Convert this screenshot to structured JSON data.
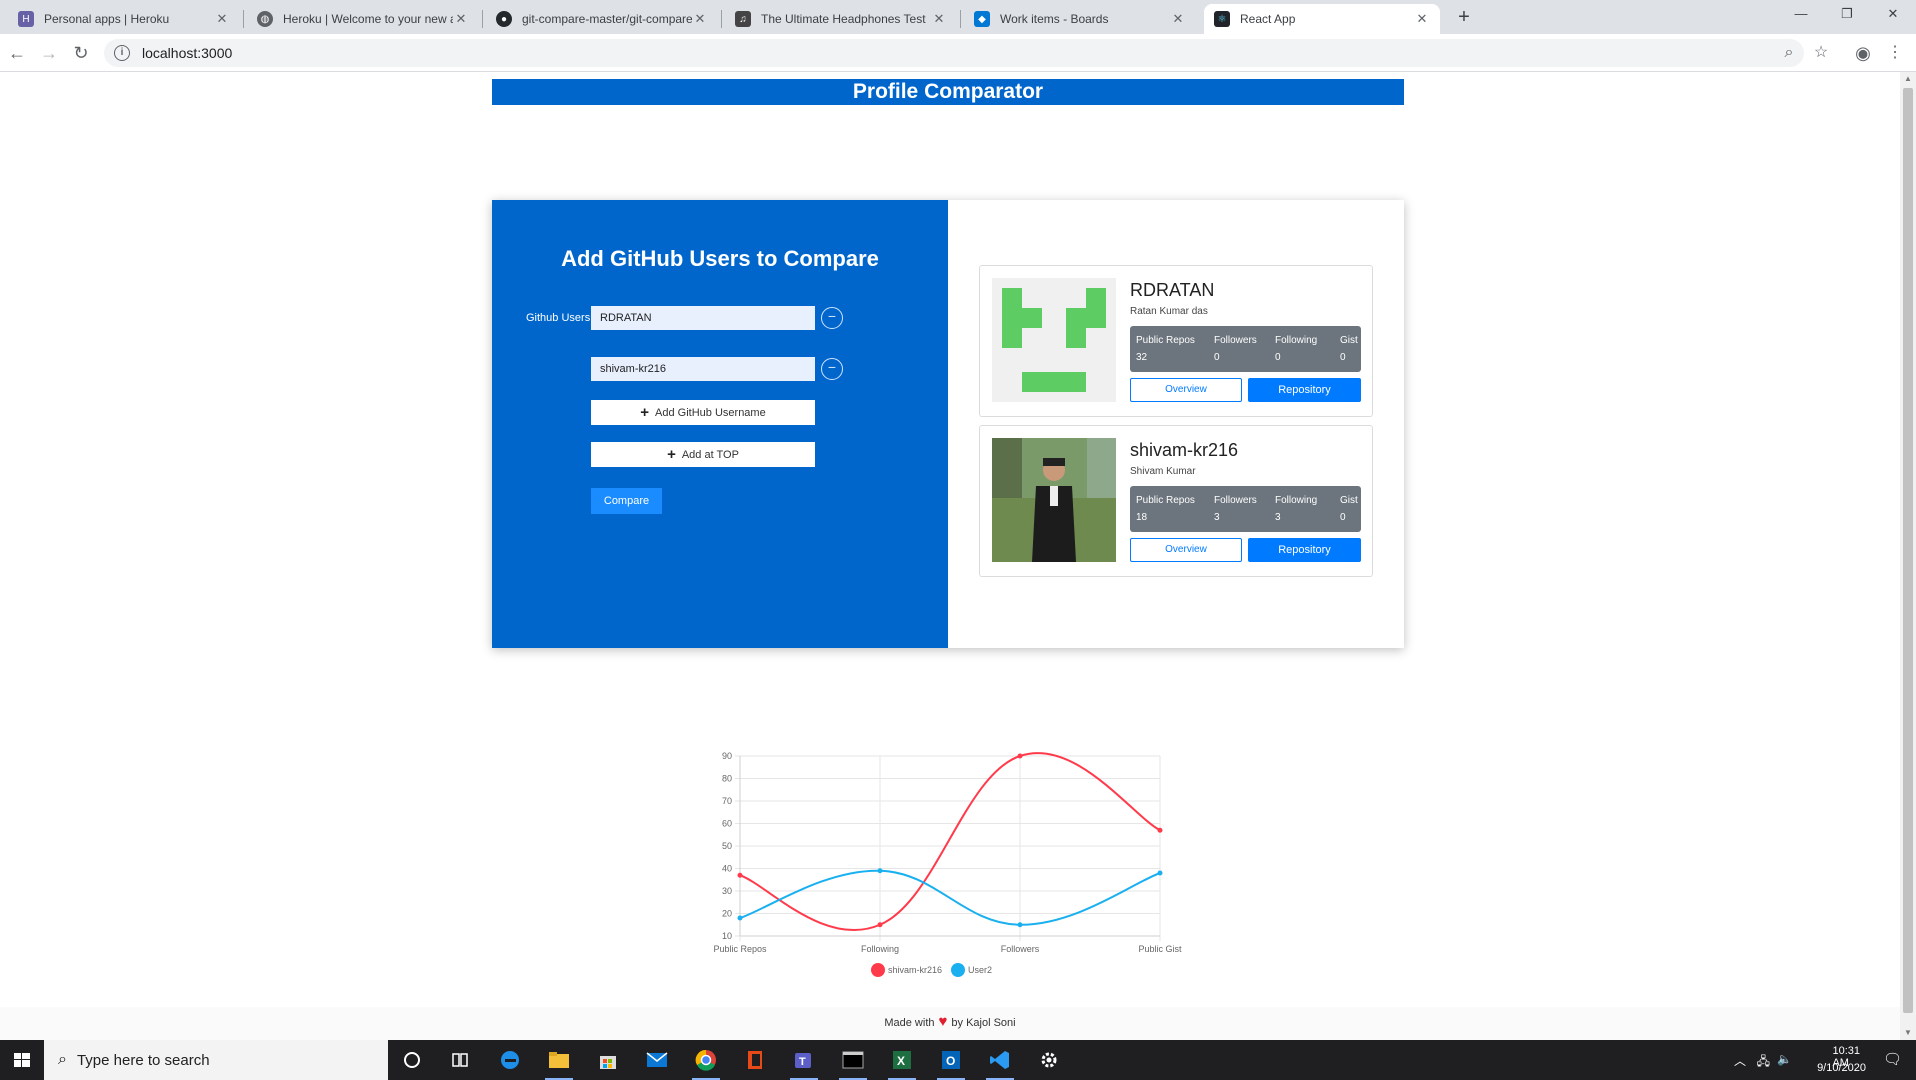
{
  "browser": {
    "tabs": [
      {
        "title": "Personal apps | Heroku",
        "icon": "heroku-icon",
        "color": "#6762a6"
      },
      {
        "title": "Heroku | Welcome to your new a",
        "icon": "globe-icon",
        "color": "#5f6368"
      },
      {
        "title": "git-compare-master/git-compare",
        "icon": "github-icon",
        "color": "#24292e"
      },
      {
        "title": "The Ultimate Headphones Test",
        "icon": "headphones-icon",
        "color": "#444444"
      },
      {
        "title": "Work items - Boards",
        "icon": "azure-devops-icon",
        "color": "#0078d4"
      },
      {
        "title": "React App",
        "icon": "react-icon",
        "color": "#20232a"
      }
    ],
    "active_tab": 5,
    "url": "localhost:3000"
  },
  "page": {
    "banner_title": "Profile Comparator",
    "form": {
      "title": "Add GitHub Users to Compare",
      "users_label": "Github Users",
      "usernames": [
        "RDRATAN",
        "shivam-kr216"
      ],
      "add_username_label": "Add GitHub Username",
      "add_top_label": "Add at TOP",
      "compare_label": "Compare"
    },
    "stat_headers": [
      "Public Repos",
      "Followers",
      "Following",
      "Gist"
    ],
    "profiles": [
      {
        "username": "RDRATAN",
        "name": "Ratan Kumar das",
        "stats": [
          "32",
          "0",
          "0",
          "0"
        ],
        "overview_label": "Overview",
        "repo_label": "Repository"
      },
      {
        "username": "shivam-kr216",
        "name": "Shivam Kumar",
        "stats": [
          "18",
          "3",
          "3",
          "0"
        ],
        "overview_label": "Overview",
        "repo_label": "Repository"
      }
    ],
    "footer": {
      "prefix": "Made with",
      "suffix": "by Kajol Soni"
    }
  },
  "chart_data": {
    "type": "line",
    "categories": [
      "Public Repos",
      "Following",
      "Followers",
      "Public Gist"
    ],
    "series": [
      {
        "name": "shivam-kr216",
        "values": [
          37,
          15,
          90,
          57
        ],
        "color": "#ff3b4b"
      },
      {
        "name": "User2",
        "values": [
          18,
          39,
          15,
          38
        ],
        "color": "#1ab0f0"
      }
    ],
    "yticks": [
      10,
      20,
      30,
      40,
      50,
      60,
      70,
      80,
      90
    ],
    "ylim": [
      10,
      90
    ],
    "grid": true,
    "legend": "bottom"
  },
  "taskbar": {
    "search_placeholder": "Type here to search",
    "time": "10:31 AM",
    "date": "9/10/2020"
  }
}
